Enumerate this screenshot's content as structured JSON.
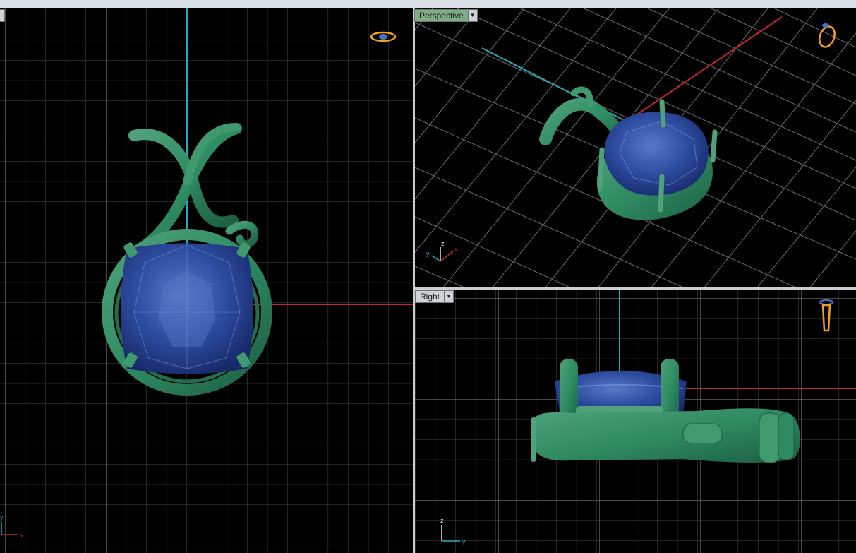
{
  "viewports": {
    "top": {
      "label": ""
    },
    "perspective": {
      "label": "Perspective"
    },
    "right": {
      "label": "Right"
    }
  },
  "axis_labels": {
    "top": {
      "x": "x",
      "y": "y"
    },
    "perspective": {
      "x": "x",
      "y": "y",
      "z": "z"
    },
    "right": {
      "y": "y",
      "z": "z"
    }
  },
  "icons": {
    "viewport_dropdown": "chevron-down-icon",
    "view_cube": "ring-navigation-icon"
  },
  "colors": {
    "grid": "#5a5a5a",
    "grid_major": "#9a9a9a",
    "axis_x": "#c62828",
    "axis_y": "#2aa7b8",
    "metal": "#2e8b62",
    "gem": "#2d4a9c",
    "active_label": "#7fae86",
    "inactive_label": "#cfd3d6"
  }
}
